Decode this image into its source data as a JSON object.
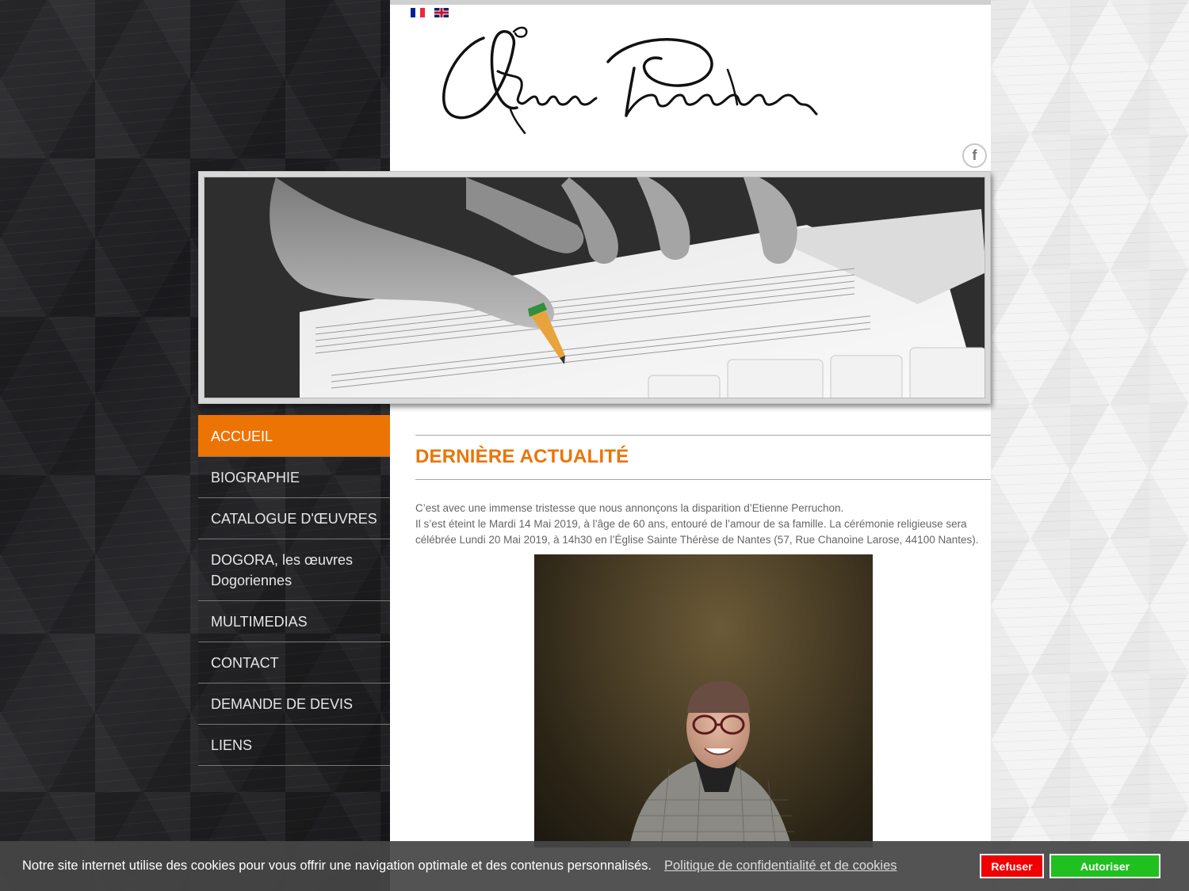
{
  "languages": [
    {
      "name": "fr-flag-icon",
      "label": "Français"
    },
    {
      "name": "en-flag-icon",
      "label": "English"
    }
  ],
  "logo": {
    "alt": "Étienne Perruchon"
  },
  "social": {
    "facebook_label": "f"
  },
  "nav": {
    "items": [
      {
        "label": "ACCUEIL"
      },
      {
        "label": "BIOGRAPHIE"
      },
      {
        "label": "CATALOGUE D'ŒUVRES"
      },
      {
        "label": "DOGORA, les œuvres Dogoriennes"
      },
      {
        "label": "MULTIMEDIAS"
      },
      {
        "label": "CONTACT"
      },
      {
        "label": "DEMANDE DE DEVIS"
      },
      {
        "label": "LIENS"
      }
    ]
  },
  "main": {
    "section_title": "DERNIÈRE ACTUALITÉ",
    "paragraphs": [
      "C’est avec une immense tristesse que nous annonçons la disparition d’Etienne Perruchon.",
      "Il s’est éteint le Mardi 14 Mai 2019, à l’âge de 60 ans, entouré de l’amour de sa famille. La cérémonie religieuse sera célébrée Lundi 20 Mai 2019, à 14h30 en l’Église Sainte Thérèse de Nantes (57, Rue Chanoine Larose, 44100 Nantes)."
    ]
  },
  "cookie": {
    "text": "Notre site internet utilise des cookies pour vous offrir une navigation optimale et des contenus personnalisés.",
    "link": "Politique de confidentialité et de cookies",
    "refuse": "Refuser",
    "allow": "Autoriser"
  },
  "colors": {
    "accent": "#ec7405",
    "refuse": "#f00000",
    "allow": "#20c020"
  }
}
